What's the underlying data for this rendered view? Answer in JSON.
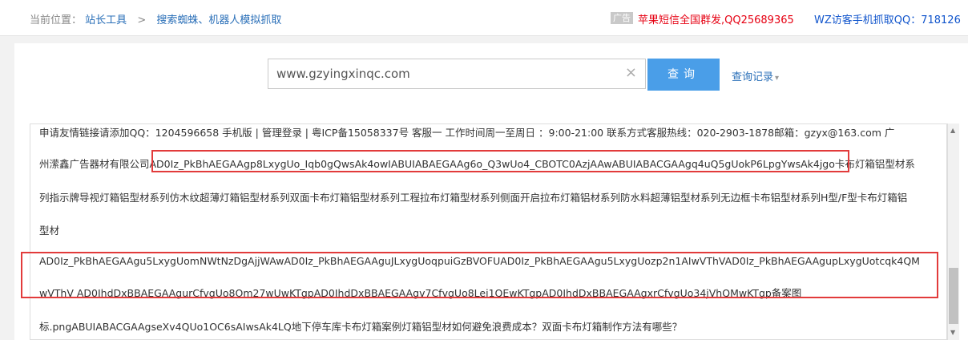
{
  "breadcrumb": {
    "label": "当前位置：",
    "items": [
      "站长工具",
      "搜索蜘蛛、机器人模拟抓取"
    ],
    "separator": ">"
  },
  "ads": {
    "badge": "广告",
    "ad1": "苹果短信全国群发,QQ25689365",
    "ad2": "WZ访客手机抓取QQ：718126"
  },
  "search": {
    "value": "www.gzyingxinqc.com",
    "clear_icon": "×",
    "button_label": "查询",
    "history_label": "查询记录",
    "history_caret": "▾"
  },
  "content": {
    "lines": [
      "申请友情链接请添加QQ：1204596658 手机版 | 管理登录 | 粤ICP备15058337号     客服一 工作时间周一至周日 ：9:00-21:00 联系方式客服热线：020-2903-1878邮箱：gzyx@163.com 广",
      "州潆鑫广告器材有限公司AD0Iz_PkBhAEGAAgp8LxygUo_Iqb0gQwsAk4owIABUIABAEGAAg6o_Q3wUo4_CBOTC0AzjAAwABUIABACGAAgq4uQ5gUokP6LpgYwsAk4jgo卡布灯箱铝型材系",
      "列指示牌导视灯箱铝型材系列仿木纹超薄灯箱铝型材系列双面卡布灯箱铝型材系列工程拉布灯箱型材系列侧面开启拉布灯箱铝材系列防水料超薄铝型材系列无边框卡布铝型材系列H型/F型卡布灯箱铝",
      "型材",
      "AD0Iz_PkBhAEGAAgu5LxygUomNWtNzDgAjjWAwAD0Iz_PkBhAEGAAguJLxygUoqpuiGzBVOFUAD0Iz_PkBhAEGAAgu5LxygUozp2n1AIwVThVAD0Iz_PkBhAEGAAgupLxygUotcqk4QM",
      "wVThV AD0IhdDxBBAEGAAgurCfvgUo8Om27wUwKTgpAD0IhdDxBBAEGAAgv7CfvgUo8Lei1QEwKTgpAD0IhdDxBBAEGAAgxrCfvgUo34jVhQMwKTgp备案图",
      "标.pngABUIABACGAAgseXv4QUo1OC6sAIwsAk4LQ地下停车库卡布灯箱案例灯箱铝型材如何避免浪费成本？双面卡布灯箱制作方法有哪些？"
    ]
  },
  "colors": {
    "link": "#2a6fb8",
    "ad_red": "#e60012",
    "ad_blue": "#1155cc",
    "button": "#4a9ee8",
    "highlight": "#e23b3b"
  }
}
